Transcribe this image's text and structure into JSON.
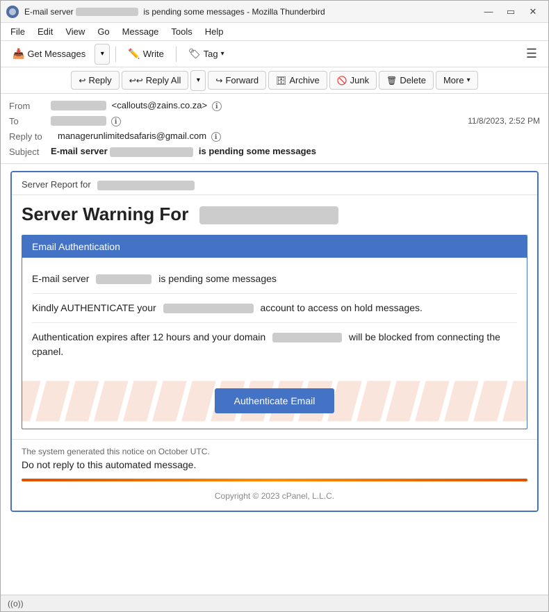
{
  "window": {
    "title": "E-mail server          is pending some messages - Mozilla Thunderbird",
    "title_short": "E-mail server",
    "title_suffix": "is pending some messages - Mozilla Thunderbird"
  },
  "menu": {
    "items": [
      "File",
      "Edit",
      "View",
      "Go",
      "Message",
      "Tools",
      "Help"
    ]
  },
  "toolbar1": {
    "get_messages": "Get Messages",
    "write": "Write",
    "tag": "Tag",
    "dropdown_arrow": "▾"
  },
  "toolbar2": {
    "reply": "Reply",
    "reply_all": "Reply All",
    "forward": "Forward",
    "archive": "Archive",
    "junk": "Junk",
    "delete": "Delete",
    "more": "More"
  },
  "email_header": {
    "from_label": "From",
    "from_name": "████████",
    "from_email": "<callouts@zains.co.za>",
    "to_label": "To",
    "to_value": "████████████",
    "date": "11/8/2023, 2:52 PM",
    "reply_to_label": "Reply to",
    "reply_to_email": "managerunlimitedsafaris@gmail.com",
    "subject_label": "Subject",
    "subject_prefix": "E-mail server",
    "subject_blurred": "████████████",
    "subject_suffix": "is pending some messages"
  },
  "email_body": {
    "server_report_prefix": "Server Report for",
    "server_report_blurred": "████████████████",
    "warning_title": "Server Warning For",
    "warning_blurred": "██████████████████████",
    "auth_header": "Email Authentication",
    "pending_prefix": "E-mail server",
    "pending_blurred": "████████",
    "pending_suffix": "is pending some messages",
    "authenticate_prefix": "Kindly AUTHENTICATE your",
    "authenticate_blurred": "████████████████",
    "authenticate_suffix": "account to access on hold messages.",
    "expiry_prefix": "Authentication expires after 12 hours  and your domain",
    "expiry_blurred": "██████████████",
    "expiry_suffix": "will be blocked from connecting the cpanel.",
    "authenticate_btn": "Authenticate Email",
    "watermark": "████████████",
    "footer_small": "The system generated this notice on October UTC.",
    "footer_main": "Do not reply to this automated message.",
    "copyright": "Copyright © 2023 cPanel, L.L.C."
  },
  "status_bar": {
    "wifi_label": "((o))"
  },
  "colors": {
    "accent_blue": "#4472c4",
    "orange": "#e05000"
  }
}
